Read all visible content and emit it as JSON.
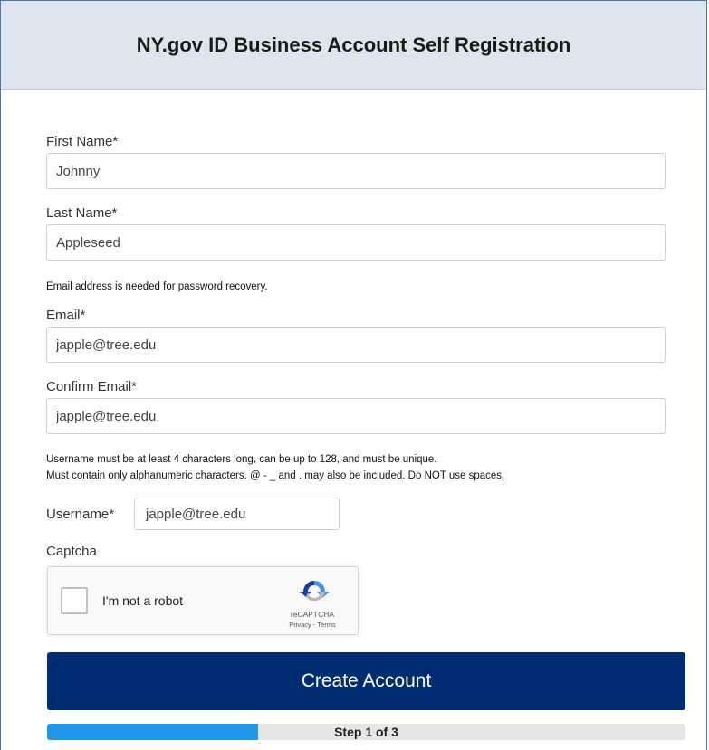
{
  "header": {
    "title": "NY.gov ID Business Account Self Registration"
  },
  "form": {
    "first_name": {
      "label": "First Name*",
      "value": "Johnny"
    },
    "last_name": {
      "label": "Last Name*",
      "value": "Appleseed"
    },
    "email_note": "Email address is needed for password recovery.",
    "email": {
      "label": "Email*",
      "value": "japple@tree.edu"
    },
    "confirm_email": {
      "label": "Confirm Email*",
      "value": "japple@tree.edu"
    },
    "username_note_line1": "Username must be at least 4 characters long, can be up to 128, and must be unique.",
    "username_note_line2": "Must contain only alphanumeric characters. @ - _ and . may also be included. Do NOT use spaces.",
    "username": {
      "label": "Username*",
      "value": "japple@tree.edu"
    },
    "captcha_label": "Captcha"
  },
  "captcha": {
    "checkbox_text": "I'm not a robot",
    "brand": "reCAPTCHA",
    "links": "Privacy - Terms",
    "checked": false
  },
  "actions": {
    "create_account": "Create Account"
  },
  "progress": {
    "label": "Step 1 of 3",
    "fraction": 0.33,
    "fill_color": "#2196e8"
  },
  "colors": {
    "header_bg": "#dfe5ee",
    "button_bg": "#002d72",
    "frame_border": "#4a76b8"
  }
}
